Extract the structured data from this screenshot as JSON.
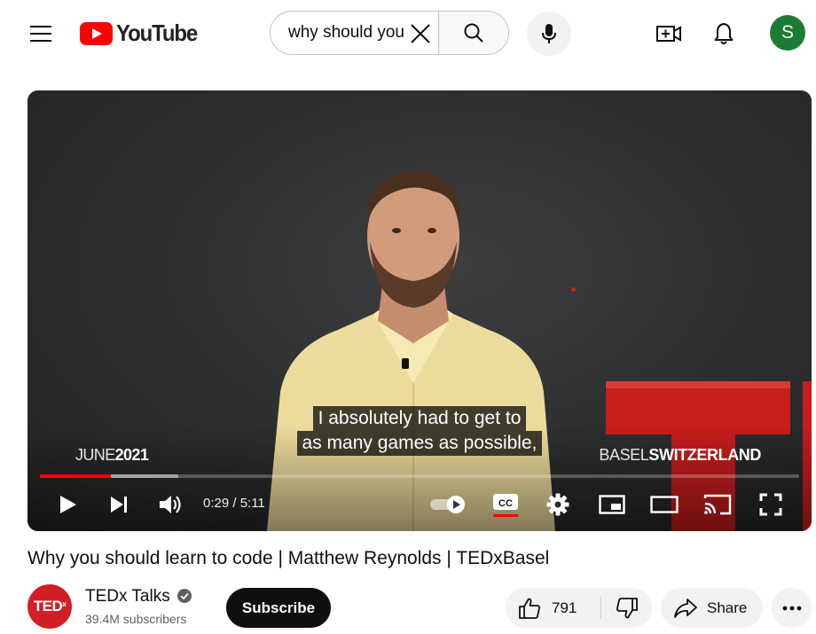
{
  "header": {
    "logo_text": "YouTube",
    "search_value": "why should you",
    "avatar_letter": "S"
  },
  "player": {
    "caption_lines": [
      "I absolutely had to get to",
      "as many games as possible,"
    ],
    "event_month": "JUNE",
    "event_year": "2021",
    "event_city": "BASEL",
    "event_country": "SWITZERLAND",
    "current_time": "0:29",
    "duration": "5:11",
    "time_display": "0:29 / 5:11",
    "progress_played_fraction": 0.093,
    "progress_buffered_fraction": 0.182,
    "autoplay_on": true,
    "captions_on": true
  },
  "video": {
    "title": "Why you should learn to code | Matthew Reynolds | TEDxBasel"
  },
  "channel": {
    "avatar_text": "TED",
    "avatar_sup": "x",
    "name": "TEDx Talks",
    "subscribers": "39.4M subscribers",
    "subscribe_label": "Subscribe"
  },
  "actions": {
    "like_count": "791",
    "share_label": "Share"
  },
  "colors": {
    "brand_red": "#ff0000",
    "avatar_green": "#1e7b34",
    "ted_red": "#d21f23"
  }
}
